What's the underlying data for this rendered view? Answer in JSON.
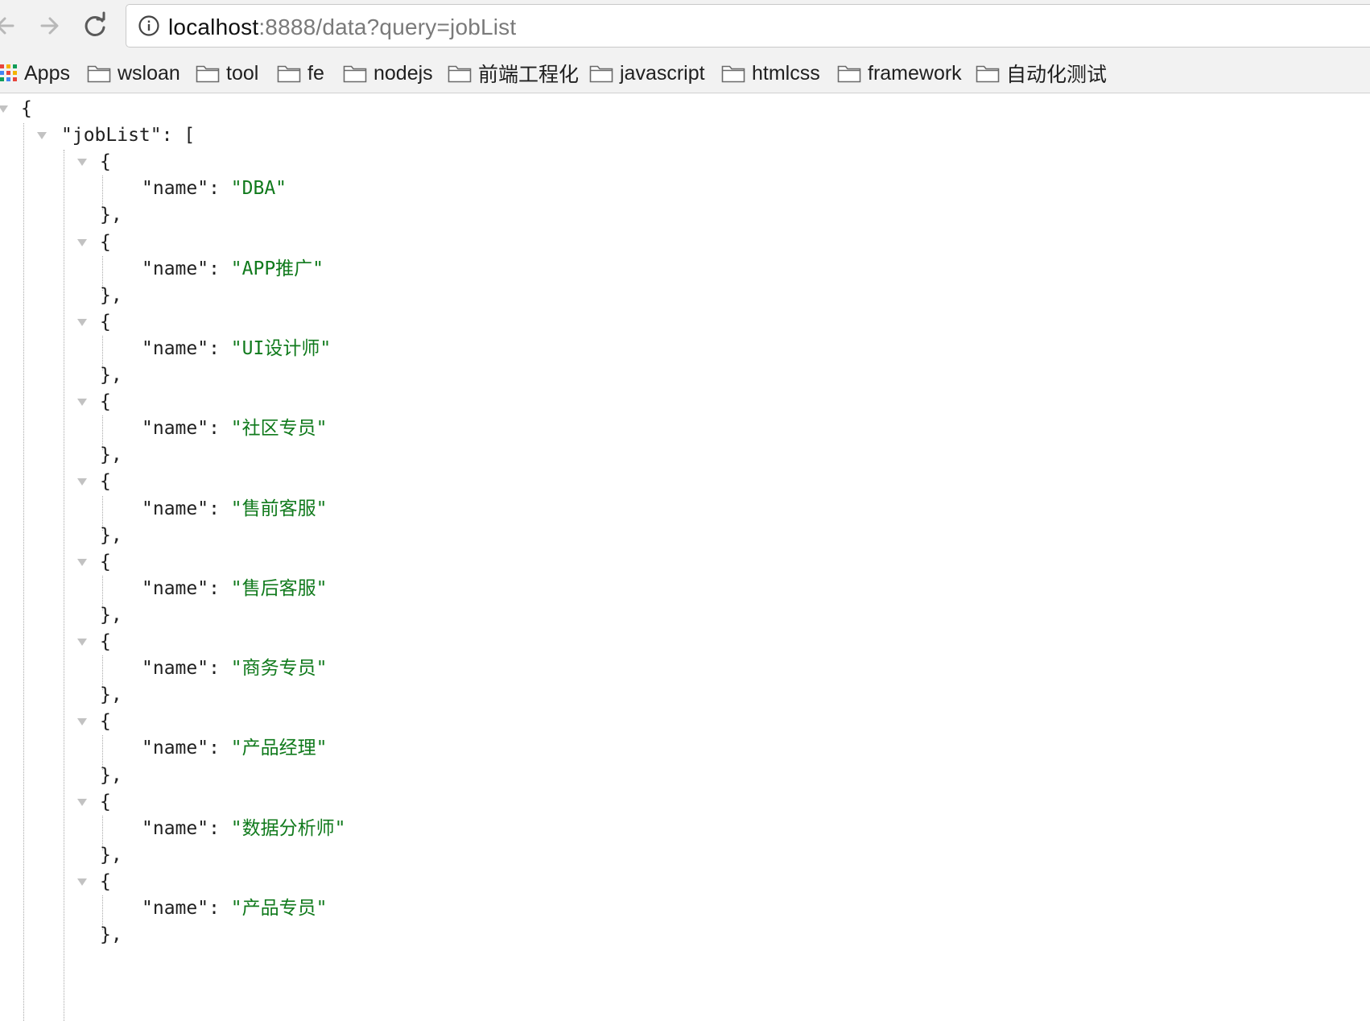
{
  "browser": {
    "url_host": "localhost",
    "url_rest": ":8888/data?query=jobList"
  },
  "bookmarks": [
    {
      "label": "Apps",
      "icon": "apps-grid-icon"
    },
    {
      "label": "wsloan",
      "icon": "folder-icon"
    },
    {
      "label": "tool",
      "icon": "folder-icon"
    },
    {
      "label": "fe",
      "icon": "folder-icon"
    },
    {
      "label": "nodejs",
      "icon": "folder-icon"
    },
    {
      "label": "前端工程化",
      "icon": "folder-icon"
    },
    {
      "label": "javascript",
      "icon": "folder-icon"
    },
    {
      "label": "htmlcss",
      "icon": "folder-icon"
    },
    {
      "label": "framework",
      "icon": "folder-icon"
    },
    {
      "label": "自动化测试",
      "icon": "folder-icon"
    }
  ],
  "json": {
    "open_brace": "{",
    "root_key": "\"jobList\"",
    "colon_bracket": ": [",
    "item_open": "{",
    "item_close": "},",
    "item_key": "\"name\"",
    "item_colon": ": ",
    "items": [
      "\"DBA\"",
      "\"APP推广\"",
      "\"UI设计师\"",
      "\"社区专员\"",
      "\"售前客服\"",
      "\"售后客服\"",
      "\"商务专员\"",
      "\"产品经理\"",
      "\"数据分析师\"",
      "\"产品专员\""
    ]
  },
  "colors": {
    "string": "#107a1c",
    "text": "#202020",
    "chrome": "#f2f2f2"
  }
}
